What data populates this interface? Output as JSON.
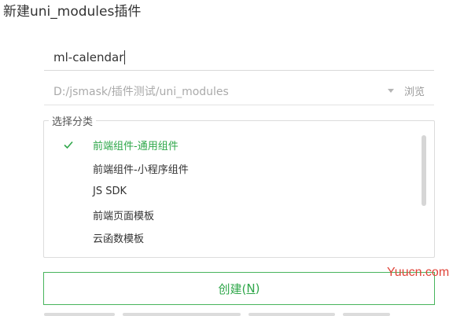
{
  "dialog": {
    "title": "新建uni_modules插件"
  },
  "plugin_name": {
    "value": "ml-calendar"
  },
  "path": {
    "value": "D:/jsmask/插件测试/uni_modules",
    "dropdown_icon": "chevron-down-icon",
    "browse_label": "浏览"
  },
  "category": {
    "legend": "选择分类",
    "items": [
      {
        "label": "前端组件-通用组件",
        "selected": true
      },
      {
        "label": "前端组件-小程序组件",
        "selected": false
      },
      {
        "label": "JS SDK",
        "selected": false
      },
      {
        "label": "前端页面模板",
        "selected": false
      },
      {
        "label": "云函数模板",
        "selected": false
      }
    ]
  },
  "create_button": {
    "label_prefix": "创建(",
    "shortcut_key": "N",
    "label_suffix": ")"
  },
  "watermark": {
    "text": "Yuucn.com"
  },
  "colors": {
    "accent": "#2fa74a",
    "accent_border": "#47b45c",
    "watermark": "#e0453a"
  }
}
